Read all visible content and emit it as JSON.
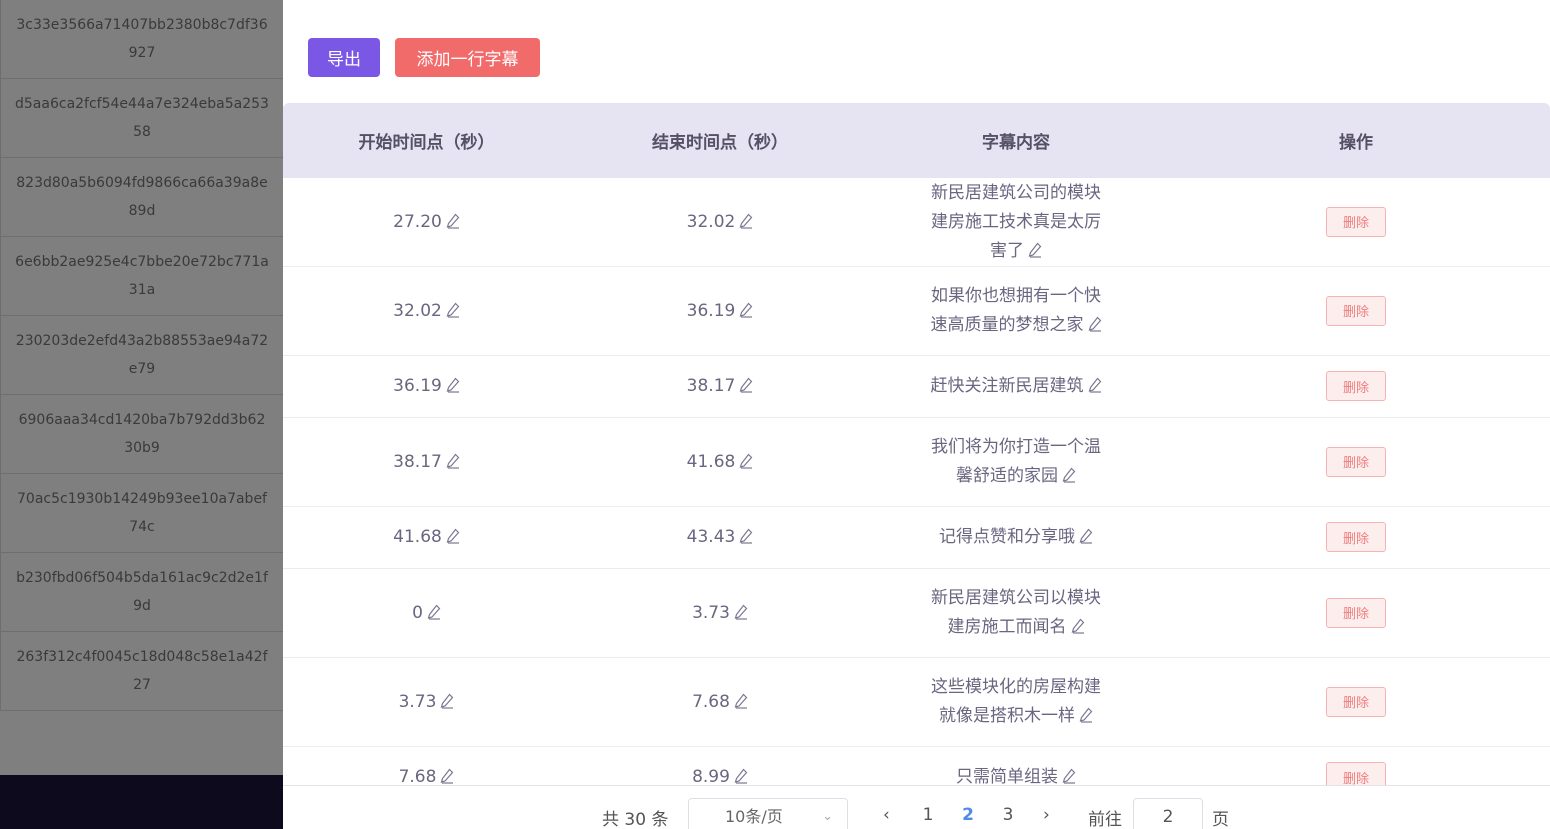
{
  "background_list": [
    {
      "line1": "3c33e3566a71407bb2380b8c7df36",
      "line2": "927"
    },
    {
      "line1": "d5aa6ca2fcf54e44a7e324eba5a253",
      "line2": "58"
    },
    {
      "line1": "823d80a5b6094fd9866ca66a39a8e",
      "line2": "89d"
    },
    {
      "line1": "6e6bb2ae925e4c7bbe20e72bc771a",
      "line2": "31a"
    },
    {
      "line1": "230203de2efd43a2b88553ae94a72",
      "line2": "e79"
    },
    {
      "line1": "6906aaa34cd1420ba7b792dd3b62",
      "line2": "30b9"
    },
    {
      "line1": "70ac5c1930b14249b93ee10a7abef",
      "line2": "74c"
    },
    {
      "line1": "b230fbd06f504b5da161ac9c2d2e1f",
      "line2": "9d"
    },
    {
      "line1": "263f312c4f0045c18d048c58e1a42f",
      "line2": "27"
    }
  ],
  "toolbar": {
    "export_label": "导出",
    "add_label": "添加一行字幕"
  },
  "table": {
    "headers": [
      "开始时间点（秒）",
      "结束时间点（秒）",
      "字幕内容",
      "操作"
    ],
    "delete_label": "删除",
    "rows": [
      {
        "start": "27.20",
        "end": "32.02",
        "text": "新民居建筑公司的模块建房施工技术真是太厉害了",
        "tall": true
      },
      {
        "start": "32.02",
        "end": "36.19",
        "text": "如果你也想拥有一个快速高质量的梦想之家",
        "tall": true
      },
      {
        "start": "36.19",
        "end": "38.17",
        "text": "赶快关注新民居建筑",
        "tall": false
      },
      {
        "start": "38.17",
        "end": "41.68",
        "text": "我们将为你打造一个温馨舒适的家园",
        "tall": true
      },
      {
        "start": "41.68",
        "end": "43.43",
        "text": "记得点赞和分享哦",
        "tall": false
      },
      {
        "start": "0",
        "end": "3.73",
        "text": "新民居建筑公司以模块建房施工而闻名",
        "tall": true
      },
      {
        "start": "3.73",
        "end": "7.68",
        "text": "这些模块化的房屋构建就像是搭积木一样",
        "tall": true
      },
      {
        "start": "7.68",
        "end": "8.99",
        "text": "只需简单组装",
        "tall": false
      }
    ]
  },
  "pagination": {
    "total": "共 30 条",
    "page_size": "10条/页",
    "prev": "‹",
    "next": "›",
    "pages": [
      "1",
      "2",
      "3"
    ],
    "current_page": "2",
    "goto_label": "前往",
    "goto_value": "2",
    "page_suffix": "页"
  },
  "colors": {
    "export_button": "#7b57e6",
    "add_button": "#f26b6b",
    "header_bg": "#e6e3f2",
    "active_page": "#4e8ae6"
  }
}
